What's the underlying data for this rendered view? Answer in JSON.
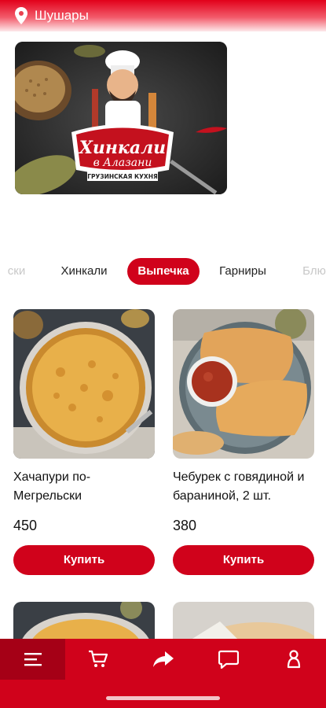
{
  "location": {
    "city": "Шушары",
    "icon": "location-pin-icon"
  },
  "banner": {
    "brand_line1": "Хинкали",
    "brand_line2": "в Алазани",
    "brand_tagline": "ГРУЗИНСКАЯ КУХНЯ"
  },
  "categories": [
    {
      "label": "ски",
      "state": "faded"
    },
    {
      "label": "Хинкали",
      "state": "normal"
    },
    {
      "label": "Выпечка",
      "state": "active"
    },
    {
      "label": "Гарниры",
      "state": "normal"
    },
    {
      "label": "Блю",
      "state": "faded"
    }
  ],
  "products": [
    {
      "name": "Хачапури по-Мегрельски",
      "price": "450",
      "buy_label": "Купить"
    },
    {
      "name": "Чебурек с говядиной и бараниной, 2 шт.",
      "price": "380",
      "buy_label": "Купить"
    }
  ],
  "bottom_nav": [
    {
      "icon": "menu-icon",
      "active": true
    },
    {
      "icon": "cart-icon",
      "active": false
    },
    {
      "icon": "share-icon",
      "active": false
    },
    {
      "icon": "chat-icon",
      "active": false
    },
    {
      "icon": "profile-icon",
      "active": false
    }
  ],
  "colors": {
    "accent": "#d0021b",
    "accent_dark": "#a50016"
  }
}
